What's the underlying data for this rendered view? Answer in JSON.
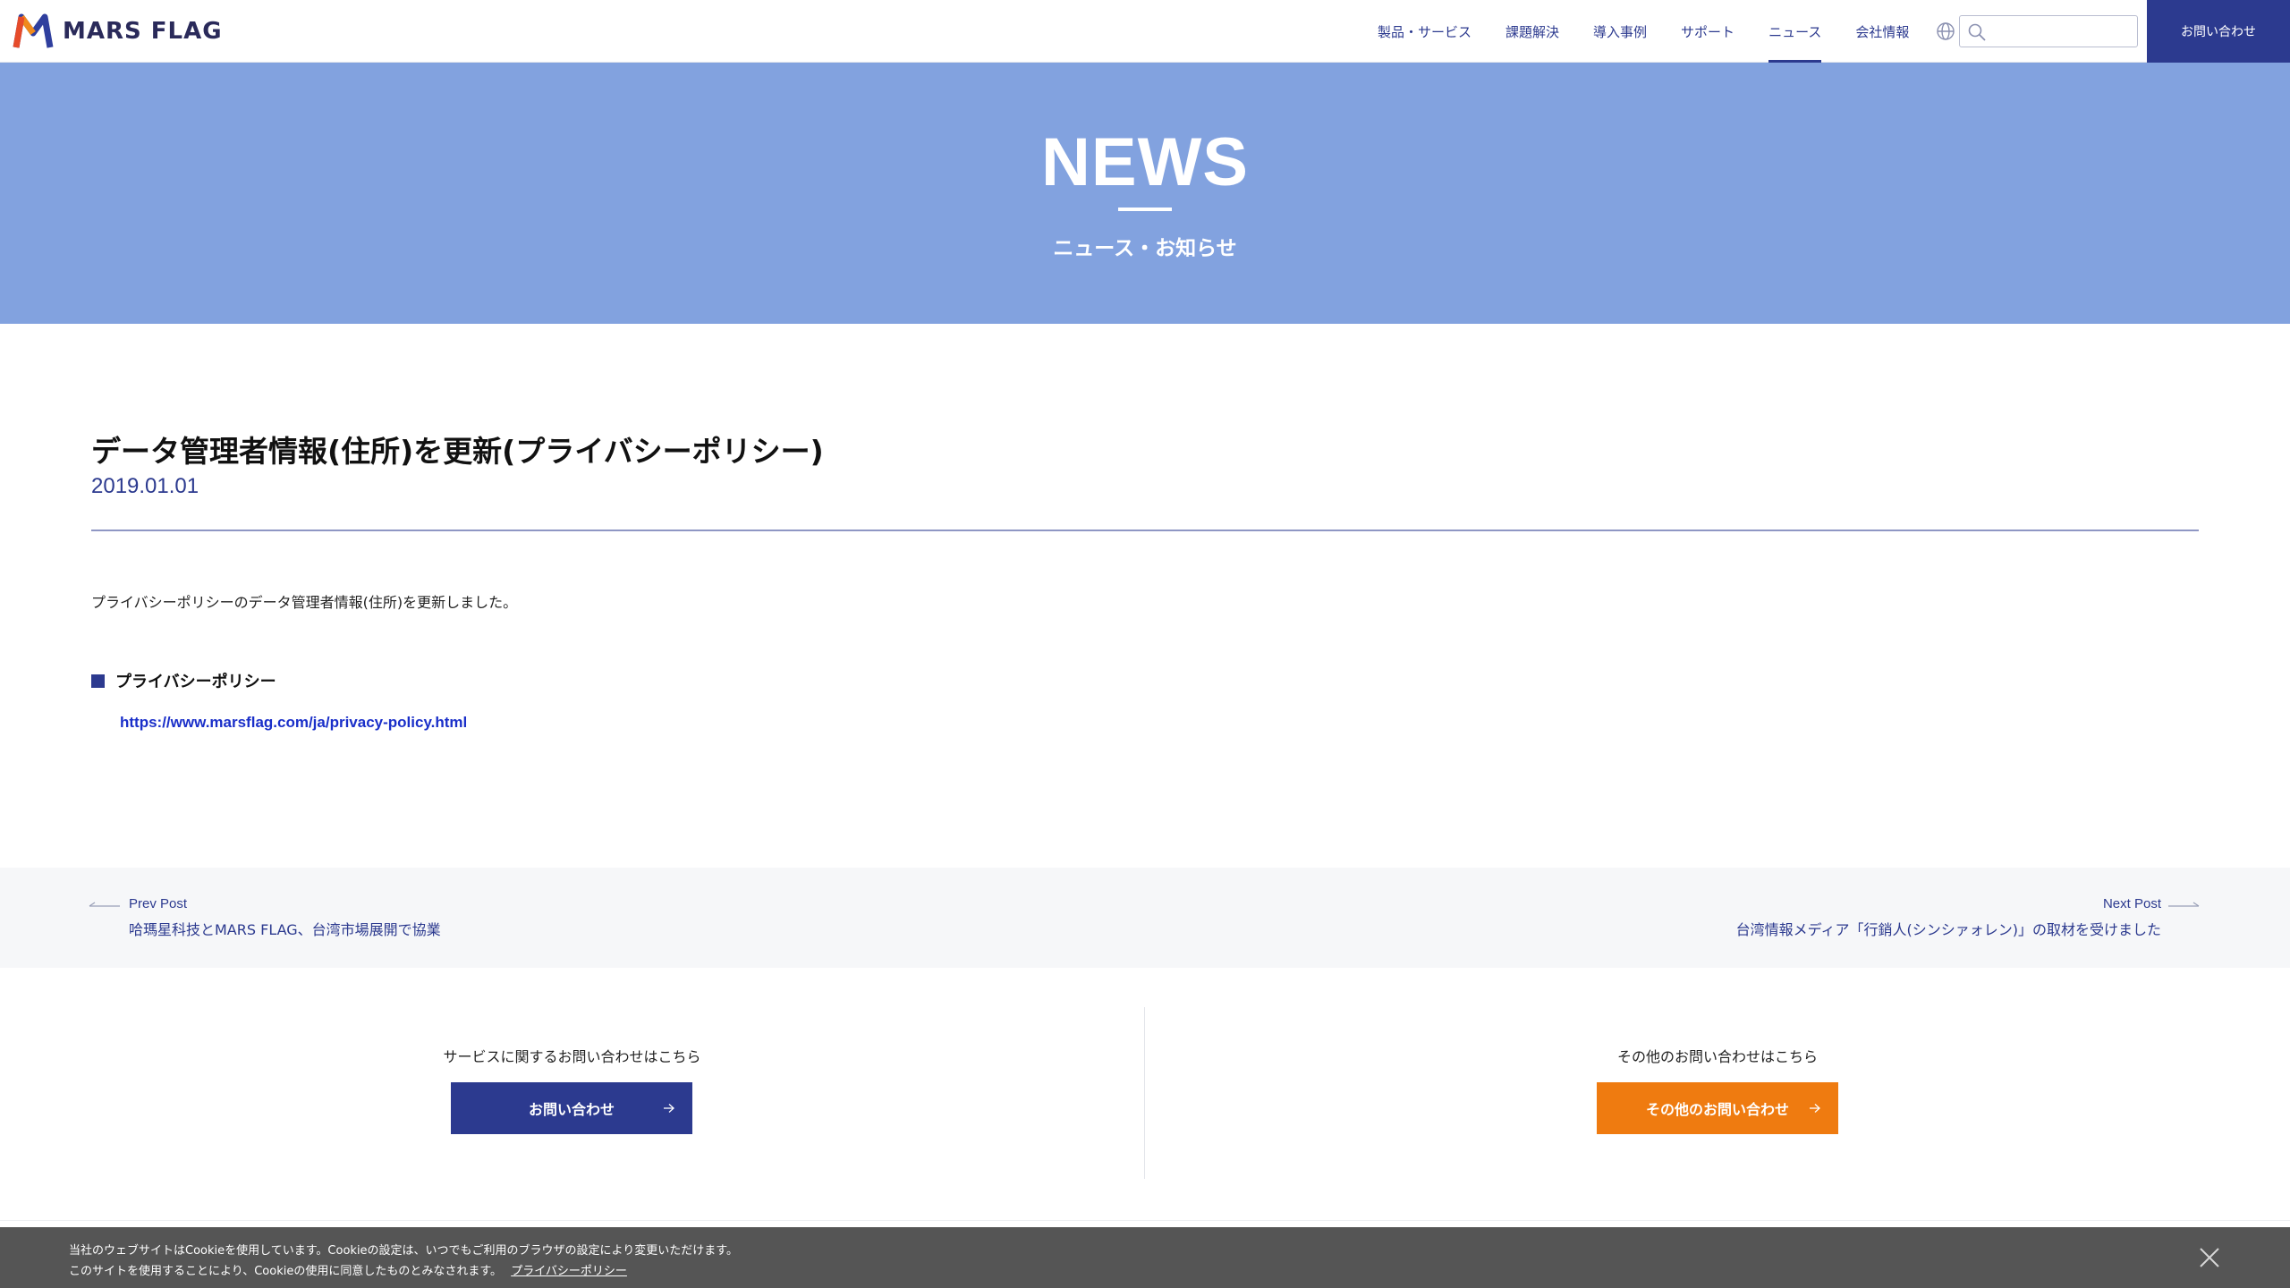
{
  "header": {
    "logo_text": "MARS FLAG",
    "nav": [
      {
        "label": "製品・サービス",
        "active": false
      },
      {
        "label": "課題解決",
        "active": false
      },
      {
        "label": "導入事例",
        "active": false
      },
      {
        "label": "サポート",
        "active": false
      },
      {
        "label": "ニュース",
        "active": true
      },
      {
        "label": "会社情報",
        "active": false
      }
    ],
    "search": {
      "value": "",
      "placeholder": ""
    },
    "contact_label": "お問い合わせ"
  },
  "hero": {
    "title": "NEWS",
    "subtitle": "ニュース・お知らせ"
  },
  "article": {
    "title": "データ管理者情報(住所)を更新(プライバシーポリシー)",
    "date": "2019.01.01",
    "body": "プライバシーポリシーのデータ管理者情報(住所)を更新しました。",
    "section_heading": "プライバシーポリシー",
    "link": "https://www.marsflag.com/ja/privacy-policy.html"
  },
  "post_nav": {
    "prev_label": "Prev Post",
    "prev_title": "哈瑪星科技とMARS FLAG、台湾市場展開で協業",
    "next_label": "Next Post",
    "next_title": "台湾情報メディア「行銷人(シンシァォレン)」の取材を受けました"
  },
  "contact": {
    "service_label": "サービスに関するお問い合わせはこちら",
    "service_button": "お問い合わせ",
    "other_label": "その他のお問い合わせはこちら",
    "other_button": "その他のお問い合わせ"
  },
  "cookie": {
    "line1": "当社のウェブサイトはCookieを使用しています。Cookieの設定は、いつでもご利用のブラウザの設定により変更いただけます。",
    "line2": "このサイトを使用することにより、Cookieの使用に同意したものとみなされます。",
    "link": "プライバシーポリシー"
  },
  "colors": {
    "brand_navy": "#2c3a8f",
    "hero_blue": "#82a2df",
    "accent_orange": "#ef7b10",
    "cookie_bg": "#555555",
    "link_blue": "#1a2fc9"
  },
  "icons": [
    "logo-icon",
    "globe-icon",
    "search-icon",
    "square-bullet-icon",
    "arrow-left-icon",
    "arrow-right-icon",
    "close-icon"
  ]
}
